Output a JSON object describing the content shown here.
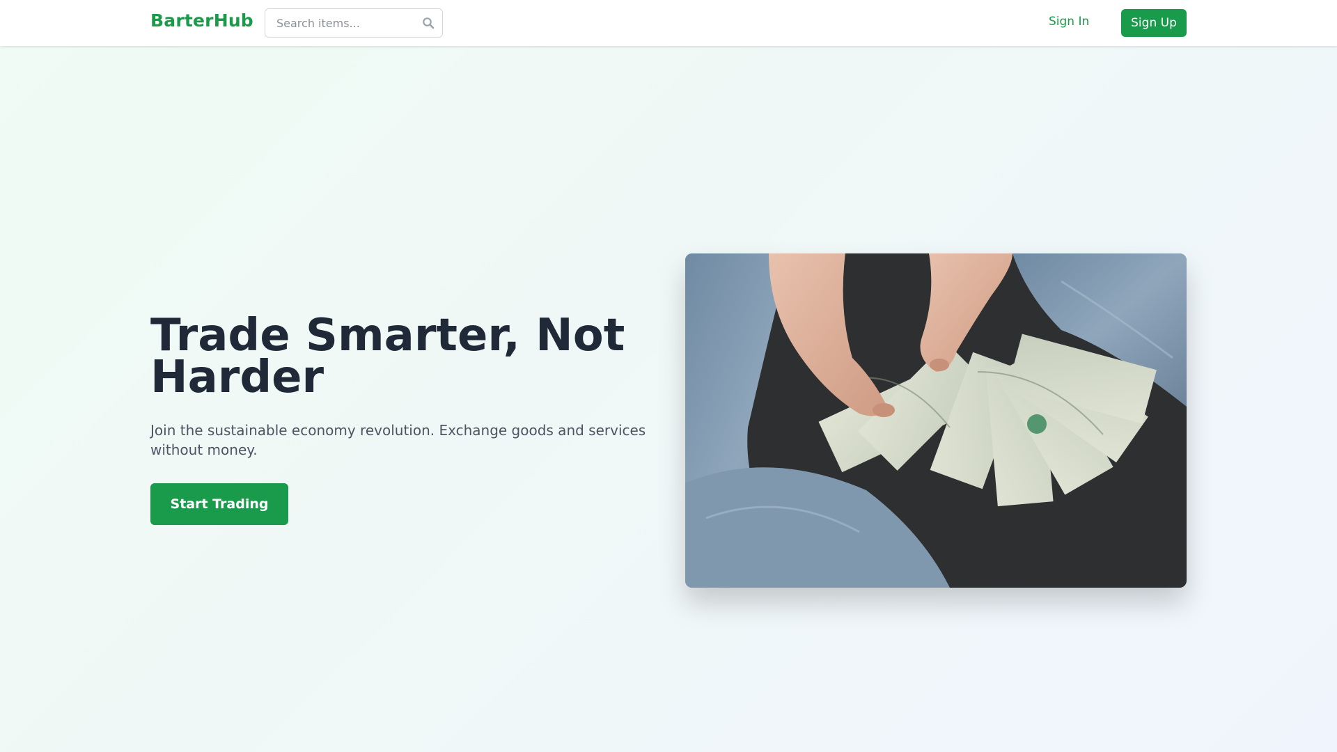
{
  "header": {
    "logo": "BarterHub",
    "search": {
      "placeholder": "Search items...",
      "value": "",
      "icon": "search-icon"
    },
    "signin_label": "Sign In",
    "signup_label": "Sign Up"
  },
  "hero": {
    "title": "Trade Smarter, Not Harder",
    "subtitle": "Join the sustainable economy revolution. Exchange goods and services without money.",
    "cta_label": "Start Trading"
  },
  "colors": {
    "brand": "#1a9b4c",
    "heading": "#1f2937",
    "text": "#4b5563"
  }
}
